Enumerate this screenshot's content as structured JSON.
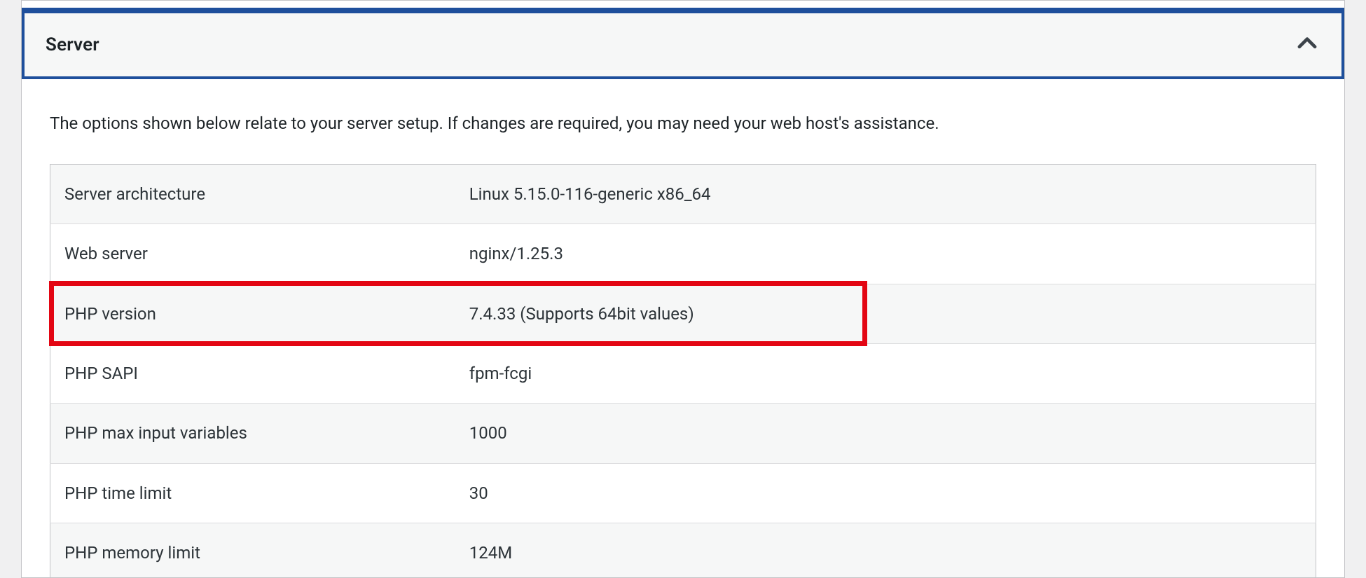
{
  "panel": {
    "title": "Server",
    "description": "The options shown below relate to your server setup. If changes are required, you may need your web host's assistance."
  },
  "rows": [
    {
      "label": "Server architecture",
      "value": "Linux 5.15.0-116-generic x86_64"
    },
    {
      "label": "Web server",
      "value": "nginx/1.25.3"
    },
    {
      "label": "PHP version",
      "value": "7.4.33 (Supports 64bit values)"
    },
    {
      "label": "PHP SAPI",
      "value": "fpm-fcgi"
    },
    {
      "label": "PHP max input variables",
      "value": "1000"
    },
    {
      "label": "PHP time limit",
      "value": "30"
    },
    {
      "label": "PHP memory limit",
      "value": "124M"
    }
  ],
  "highlight": {
    "row_index": 2,
    "color": "#e30613"
  }
}
